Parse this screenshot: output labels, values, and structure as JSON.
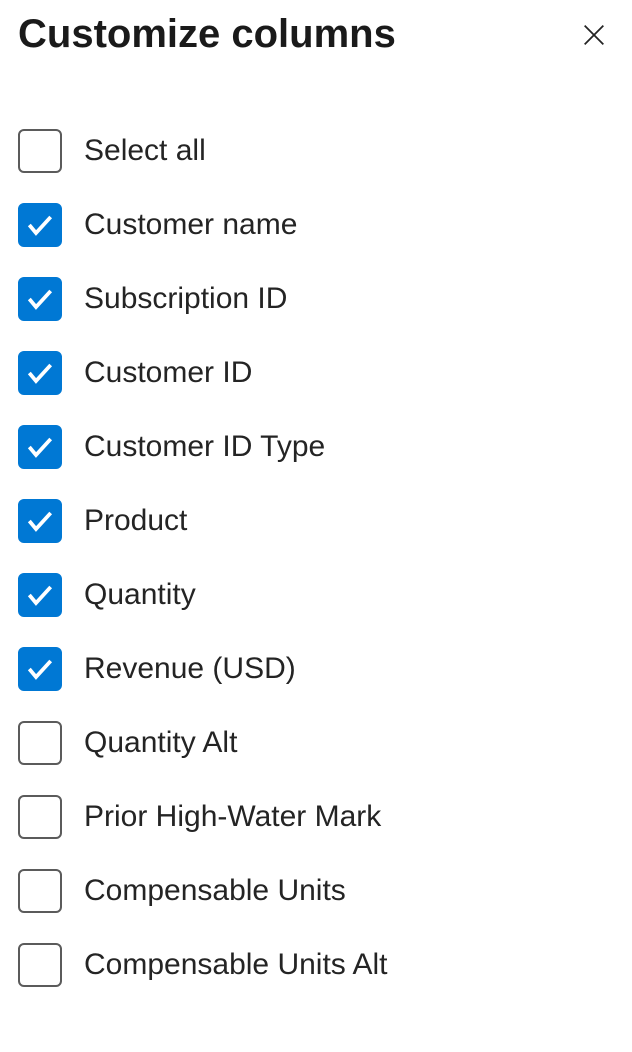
{
  "header": {
    "title": "Customize columns"
  },
  "options": [
    {
      "label": "Select all",
      "checked": false
    },
    {
      "label": "Customer name",
      "checked": true
    },
    {
      "label": "Subscription ID",
      "checked": true
    },
    {
      "label": "Customer ID",
      "checked": true
    },
    {
      "label": "Customer ID Type",
      "checked": true
    },
    {
      "label": "Product",
      "checked": true
    },
    {
      "label": "Quantity",
      "checked": true
    },
    {
      "label": "Revenue (USD)",
      "checked": true
    },
    {
      "label": "Quantity Alt",
      "checked": false
    },
    {
      "label": "Prior High-Water Mark",
      "checked": false
    },
    {
      "label": "Compensable Units",
      "checked": false
    },
    {
      "label": "Compensable Units Alt",
      "checked": false
    }
  ]
}
